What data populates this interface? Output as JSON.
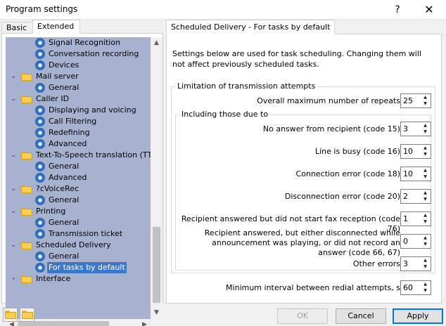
{
  "window": {
    "title": "Program settings",
    "help_glyph": "?",
    "close_glyph": "✕"
  },
  "left_tabs": {
    "basic": "Basic",
    "extended": "Extended"
  },
  "tree": [
    {
      "label": "Signal Recognition",
      "kind": "gear",
      "level": 2
    },
    {
      "label": "Conversation recording",
      "kind": "gear",
      "level": 2
    },
    {
      "label": "Devices",
      "kind": "gear",
      "level": 2
    },
    {
      "label": "Mail server",
      "kind": "folder",
      "level": 1,
      "expanded": true
    },
    {
      "label": "General",
      "kind": "gear",
      "level": 2
    },
    {
      "label": "Caller ID",
      "kind": "folder",
      "level": 1,
      "expanded": true
    },
    {
      "label": "Displaying and voicing",
      "kind": "gear",
      "level": 2
    },
    {
      "label": "Call Filtering",
      "kind": "gear",
      "level": 2
    },
    {
      "label": "Redefining",
      "kind": "gear",
      "level": 2
    },
    {
      "label": "Advanced",
      "kind": "gear",
      "level": 2
    },
    {
      "label": "Text-To-Speech translation (TTS)",
      "kind": "folder",
      "level": 1,
      "expanded": true
    },
    {
      "label": "General",
      "kind": "gear",
      "level": 2
    },
    {
      "label": "Advanced",
      "kind": "gear",
      "level": 2
    },
    {
      "label": "?cVoiceRec",
      "kind": "folder",
      "level": 1,
      "expanded": true
    },
    {
      "label": "General",
      "kind": "gear",
      "level": 2
    },
    {
      "label": "Printing",
      "kind": "folder",
      "level": 1,
      "expanded": true
    },
    {
      "label": "General",
      "kind": "gear",
      "level": 2
    },
    {
      "label": "Transmission ticket",
      "kind": "gear",
      "level": 2
    },
    {
      "label": "Scheduled Delivery",
      "kind": "folder",
      "level": 1,
      "expanded": true
    },
    {
      "label": "General",
      "kind": "gear",
      "level": 2
    },
    {
      "label": "For tasks by default",
      "kind": "gear",
      "level": 2,
      "selected": true
    },
    {
      "label": "Interface",
      "kind": "folder",
      "level": 1,
      "expanded": false
    }
  ],
  "right_tab": "Scheduled Delivery - For tasks by default",
  "description": "Settings below are used for task scheduling. Changing them will not affect previously scheduled tasks.",
  "group_outer_title": "Limitation of transmission attempts",
  "group_inner_title": "Including those due to",
  "settings": {
    "max_repeats": {
      "label": "Overall maximum number of repeats",
      "value": "25"
    },
    "no_answer": {
      "label": "No answer from recipient (code 15)",
      "value": "3"
    },
    "line_busy": {
      "label": "Line is busy (code 16)",
      "value": "10"
    },
    "conn_error": {
      "label": "Connection error (code 18)",
      "value": "10"
    },
    "disconn_error": {
      "label": "Disconnection error (code 20)",
      "value": "2"
    },
    "no_fax": {
      "label": "Recipient answered but did not start fax reception (code 76)",
      "value": "1"
    },
    "no_record": {
      "label": "Recipient answered, but either disconnected while announcement was playing, or did not record an answer (code 66, 67)",
      "value": "0"
    },
    "other": {
      "label": "Other errors",
      "value": "3"
    },
    "min_interval": {
      "label": "Minimum interval between redial attempts, s",
      "value": "60"
    }
  },
  "buttons": {
    "ok": "OK",
    "cancel": "Cancel",
    "apply": "Apply"
  },
  "icons": {
    "up": "▲",
    "down": "▼",
    "left": "◀",
    "right": "▶",
    "expanded": "⌄",
    "collapsed": "›"
  }
}
